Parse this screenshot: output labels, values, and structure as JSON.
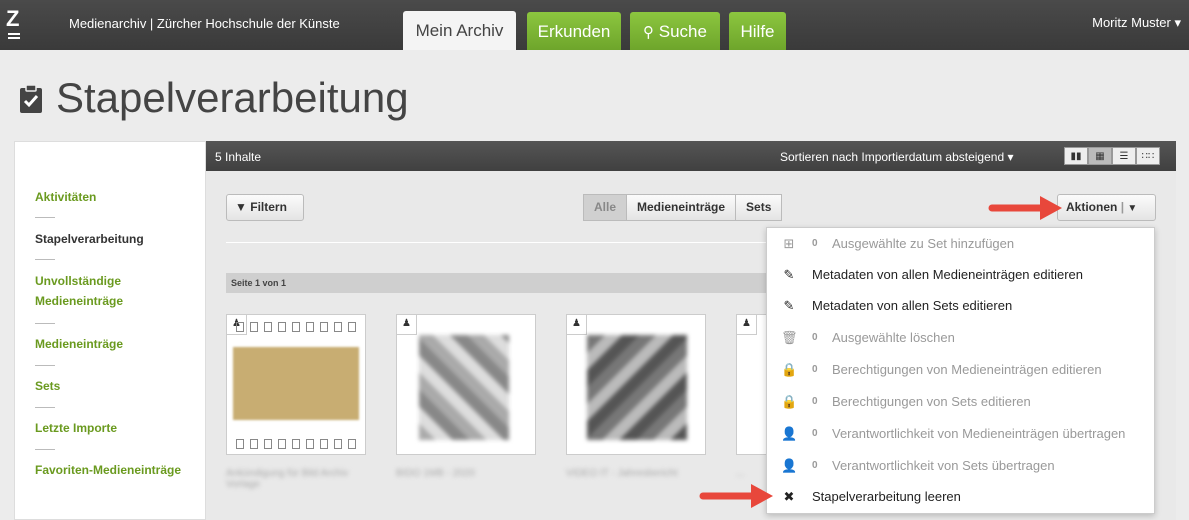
{
  "topbar": {
    "logo": "Z",
    "app_title": "Medienarchiv | Zürcher Hochschule der Künste",
    "tabs": [
      {
        "label": "Mein Archiv"
      },
      {
        "label": "Erkunden"
      },
      {
        "label": "Suche"
      },
      {
        "label": "Hilfe"
      }
    ],
    "user": "Moritz Muster ▾"
  },
  "page": {
    "title": "Stapelverarbeitung"
  },
  "sidebar": {
    "items": [
      {
        "label": "Aktivitäten"
      },
      {
        "label": "Stapelverarbeitung"
      },
      {
        "label": "Unvollständige Medieneinträge"
      },
      {
        "label": "Medieneinträge"
      },
      {
        "label": "Sets"
      },
      {
        "label": "Letzte Importe"
      },
      {
        "label": "Favoriten-Medieneinträge"
      }
    ]
  },
  "main": {
    "count": "5 Inhalte",
    "sort": "Sortieren nach Importierdatum absteigend ▾",
    "filter_label": "Filtern",
    "segments": [
      "Alle",
      "Medieneinträge",
      "Sets"
    ],
    "actions_label": "Aktionen",
    "page_label": "Seite 1 von 1",
    "captions": [
      "Ankündigung für Bild Archiv Vorlage",
      "BIDO 1MB - 2020",
      "VIDEO IT - Jahresbericht",
      "..."
    ]
  },
  "dropdown": {
    "items": [
      {
        "icon": "⊞",
        "count": "0",
        "label": "Ausgewählte zu Set hinzufügen",
        "enabled": false
      },
      {
        "icon": "✎",
        "count": "",
        "label": "Metadaten von allen Medieneinträgen editieren",
        "enabled": true
      },
      {
        "icon": "✎",
        "count": "",
        "label": "Metadaten von allen Sets editieren",
        "enabled": true
      },
      {
        "icon": "🗑",
        "count": "0",
        "label": "Ausgewählte löschen",
        "enabled": false
      },
      {
        "icon": "🔒",
        "count": "0",
        "label": "Berechtigungen von Medieneinträgen editieren",
        "enabled": false
      },
      {
        "icon": "🔒",
        "count": "0",
        "label": "Berechtigungen von Sets editieren",
        "enabled": false
      },
      {
        "icon": "👤",
        "count": "0",
        "label": "Verantwortlichkeit von Medieneinträgen übertragen",
        "enabled": false
      },
      {
        "icon": "👤",
        "count": "0",
        "label": "Verantwortlichkeit von Sets übertragen",
        "enabled": false
      },
      {
        "icon": "✖",
        "count": "",
        "label": "Stapelverarbeitung leeren",
        "enabled": true
      }
    ]
  },
  "colors": {
    "accent_green": "#8cc63f",
    "sidebar_link": "#6a9a1f",
    "arrow": "#e8473b"
  }
}
